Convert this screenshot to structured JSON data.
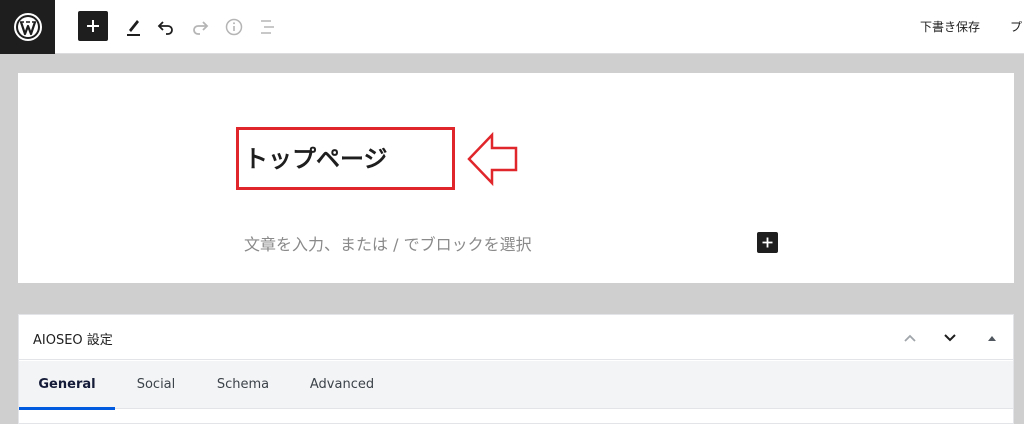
{
  "toolbar": {
    "save_draft_label": "下書き保存",
    "preview_label_partial": "プ",
    "icons": [
      "wordpress-icon",
      "plus-icon",
      "pencil-icon",
      "undo-icon",
      "redo-icon",
      "info-icon",
      "list-view-icon"
    ]
  },
  "editor": {
    "post_title": "トップページ",
    "block_placeholder": "文章を入力、または / でブロックを選択"
  },
  "annotation": {
    "highlight_color": "#e0262b"
  },
  "metabox": {
    "title": "AIOSEO 設定",
    "tabs": [
      {
        "label": "General",
        "active": true
      },
      {
        "label": "Social",
        "active": false
      },
      {
        "label": "Schema",
        "active": false
      },
      {
        "label": "Advanced",
        "active": false
      }
    ],
    "accent_color": "#005ae0"
  }
}
